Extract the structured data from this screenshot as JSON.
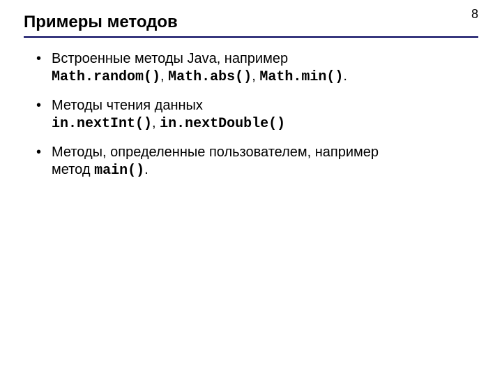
{
  "page_number": "8",
  "title": "Примеры методов",
  "bullets": [
    {
      "line1_text": "Встроенные методы Java, например",
      "line2_code1": "Math.random()",
      "line2_sep1": ", ",
      "line2_code2": "Math.abs()",
      "line2_sep2": ", ",
      "line2_code3": "Math.min()",
      "line2_tail": "."
    },
    {
      "line1_text": "Методы чтения данных",
      "line2_code1": "in.nextInt()",
      "line2_sep1": ", ",
      "line2_code2": "in.nextDouble()"
    },
    {
      "line1_text": "Методы, определенные пользователем, например",
      "line2_text": "метод ",
      "line2_code1": "main()",
      "line2_tail": "."
    }
  ]
}
